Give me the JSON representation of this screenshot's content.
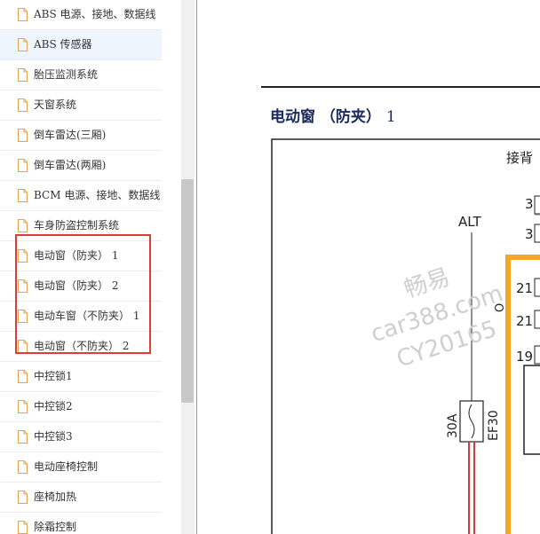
{
  "sidebar": {
    "items": [
      {
        "label": "ABS 电源、接地、数据线"
      },
      {
        "label": "ABS 传感器"
      },
      {
        "label": "胎压监测系统"
      },
      {
        "label": "天窗系统"
      },
      {
        "label": "倒车雷达(三厢)"
      },
      {
        "label": "倒车雷达(两厢)"
      },
      {
        "label": "BCM 电源、接地、数据线"
      },
      {
        "label": "车身防盗控制系统"
      },
      {
        "label": "电动窗（防夹） 1"
      },
      {
        "label": "电动窗（防夹） 2"
      },
      {
        "label": "电动车窗（不防夹） 1"
      },
      {
        "label": "电动窗（不防夹） 2"
      },
      {
        "label": "中控锁1"
      },
      {
        "label": "中控锁2"
      },
      {
        "label": "中控锁3"
      },
      {
        "label": "电动座椅控制"
      },
      {
        "label": "座椅加热"
      },
      {
        "label": "除霜控制"
      }
    ]
  },
  "document": {
    "title": "电动窗 （防夹）",
    "title_number": "1",
    "diagram": {
      "top_label": "接背",
      "alt_label": "ALT",
      "pin_labels": [
        "3",
        "3",
        "21",
        "21",
        "19"
      ],
      "o_label": "O",
      "fuse_rating": "30A",
      "fuse_id": "EF30"
    },
    "watermark": [
      "畅易",
      "car388.com",
      "CY20165"
    ]
  },
  "colors": {
    "highlight": "#e03a3a",
    "connector": "#f5a623",
    "wire": "#d23b3b",
    "title": "#1a2a5a"
  }
}
